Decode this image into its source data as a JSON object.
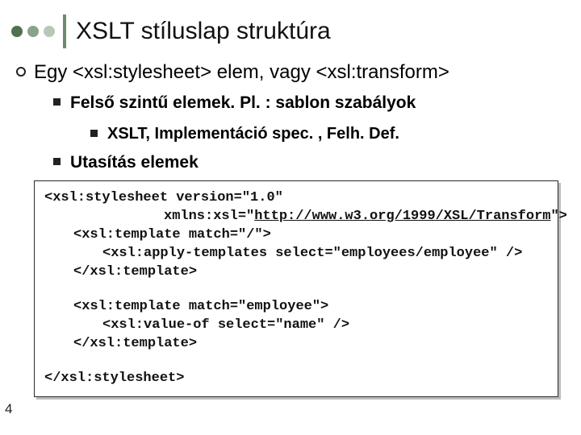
{
  "slide": {
    "title": "XSLT stíluslap struktúra",
    "number": "4"
  },
  "bullets": {
    "l1": "Egy  <xsl:stylesheet> elem, vagy <xsl:transform>",
    "l2a": "Felső szintű elemek. Pl. : sablon szabályok",
    "l3a": "XSLT, Implementáció spec. , Felh. Def.",
    "l2b": "Utasítás elemek"
  },
  "code": {
    "b1l1": "<xsl:stylesheet version=\"1.0\"",
    "b1l2": "xmlns:xsl=\"",
    "b1l2url": "http://www.w3.org/1999/XSL/Transform",
    "b1l2end": "\">",
    "b1l3": "<xsl:template match=\"/\">",
    "b1l4": "<xsl:apply-templates select=\"employees/employee\" />",
    "b1l5": "</xsl:template>",
    "b2l1": "<xsl:template match=\"employee\">",
    "b2l2": "<xsl:value-of select=\"name\" />",
    "b2l3": "</xsl:template>",
    "b3l1": "</xsl:stylesheet>"
  }
}
